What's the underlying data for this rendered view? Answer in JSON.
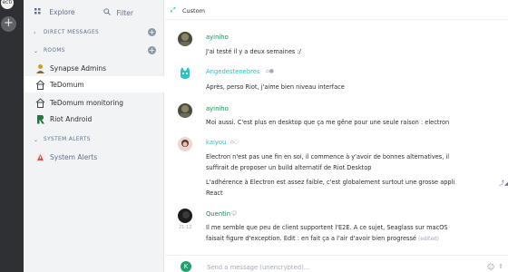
{
  "rail": {
    "top_avatar_text": "ecti",
    "add_label": "+"
  },
  "roomlist": {
    "explore_label": "Explore",
    "filter_label": "Filter",
    "sections": {
      "direct_messages": "DIRECT MESSAGES",
      "rooms": "ROOMS",
      "system_alerts": "SYSTEM ALERTS"
    },
    "rooms": [
      {
        "name": "Synapse Admins",
        "icon": "person-icon"
      },
      {
        "name": "TeDomum",
        "icon": "house-icon"
      },
      {
        "name": "TeDomum monitoring",
        "icon": "house-icon"
      },
      {
        "name": "Riot Android",
        "icon": "android-icon"
      }
    ],
    "alerts": [
      {
        "name": "System Alerts",
        "icon": "warning-icon"
      }
    ]
  },
  "header": {
    "room_title": "Custom"
  },
  "messages": [
    {
      "sender": "ayiniho",
      "sender_color": "#1a8a55",
      "lines": [
        "J'ai testé il y a deux semaines :/"
      ]
    },
    {
      "sender": "Angedestenebres",
      "sender_color": "#2dc2c5",
      "lines": [
        "Après, perso Riot, j'aime bien niveau interface"
      ]
    },
    {
      "sender": "ayiniho",
      "sender_color": "#1a8a55",
      "lines": [
        "Moi aussi. C'est plus en desktop que ça me gêne pour une seule raison : electron"
      ]
    },
    {
      "sender": "kaiyou",
      "sender_color": "#2dc2c5",
      "lines": [
        "Electron n'est pas une fin en soi, il commence à y'avoir de bonnes alternatives, il",
        "suffirait de proposer un build alternatif de Riot Desktop",
        "L'adhérence à Electron est assez faible, c'est globalement surtout une grosse appli",
        "React"
      ]
    },
    {
      "sender": "Quentin",
      "sender_color": "#1a8a55",
      "timestamp": "21:12",
      "lines": [
        "Il me semble que peu de client supportent l'E2E. A ce sujet, Seaglass sur macOS",
        "faisait figure d'exception. Edit : en fait ça a l'air d'avoir bien progressé"
      ],
      "edited": "(edited)"
    }
  ],
  "composer": {
    "avatar_letter": "K",
    "placeholder": "Send a message (unencrypted)..."
  },
  "colors": {
    "accent": "#03b381",
    "rail": "#2e3033",
    "roomlist_bg": "#f2f3f5"
  }
}
